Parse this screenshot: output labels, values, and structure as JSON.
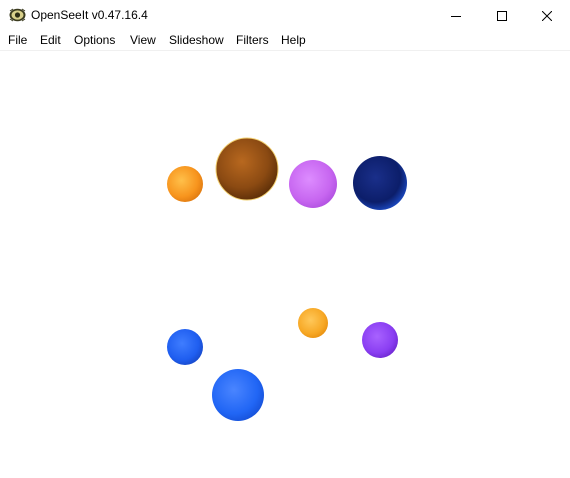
{
  "window": {
    "title": "OpenSeeIt v0.47.16.4",
    "app_icon": "openseeit-logo-icon",
    "controls": [
      "minimize-icon",
      "maximize-icon",
      "close-icon"
    ]
  },
  "menu": {
    "items": [
      {
        "label": "File"
      },
      {
        "label": "Edit"
      },
      {
        "label": "Options"
      },
      {
        "label": "View"
      },
      {
        "label": "Slideshow"
      },
      {
        "label": "Filters"
      },
      {
        "label": "Help"
      }
    ]
  },
  "image": {
    "subject": "colored spheres on white background",
    "spheres": [
      {
        "name": "orange-small-sphere",
        "color": "#f7941d"
      },
      {
        "name": "brown-sphere",
        "color": "#8b4a12"
      },
      {
        "name": "violet-sphere",
        "color": "#c766f0"
      },
      {
        "name": "navy-sphere",
        "color": "#0c1e6a"
      },
      {
        "name": "blue-small-sphere",
        "color": "#1f5ef0"
      },
      {
        "name": "orange-sphere-right",
        "color": "#f7a825"
      },
      {
        "name": "purple-sphere",
        "color": "#8a3ef2"
      },
      {
        "name": "blue-sphere",
        "color": "#2166f5"
      }
    ]
  }
}
